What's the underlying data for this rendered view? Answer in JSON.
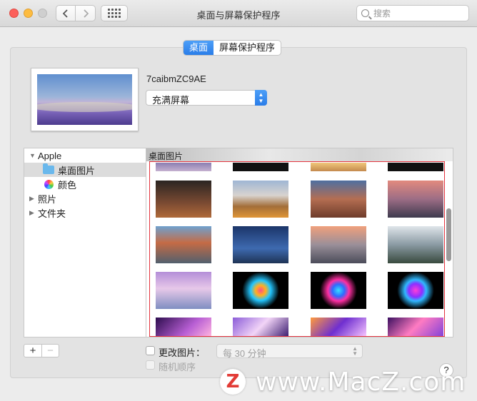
{
  "window": {
    "title": "桌面与屏幕保护程序"
  },
  "search": {
    "placeholder": "搜索"
  },
  "tabs": [
    {
      "label": "桌面",
      "active": true
    },
    {
      "label": "屏幕保护程序",
      "active": false
    }
  ],
  "preview": {
    "image_name": "7caibmZC9AE"
  },
  "fit_select": {
    "value": "充满屏幕"
  },
  "sidebar": {
    "items": [
      {
        "label": "Apple",
        "expanded": true
      },
      {
        "label": "桌面图片",
        "icon": "folder-icon",
        "selected": true
      },
      {
        "label": "颜色",
        "icon": "color-wheel-icon"
      },
      {
        "label": "照片",
        "expanded": false
      },
      {
        "label": "文件夹",
        "expanded": false
      }
    ]
  },
  "grid": {
    "header": "桌面图片"
  },
  "controls": {
    "add": "+",
    "remove": "−",
    "change_picture": {
      "label": "更改图片：",
      "checked": false
    },
    "interval": "每 30 分钟",
    "random_order": {
      "label": "随机顺序",
      "checked": false,
      "enabled": false
    }
  },
  "watermark": {
    "logo": "Z",
    "text": "www.MacZ.com"
  }
}
